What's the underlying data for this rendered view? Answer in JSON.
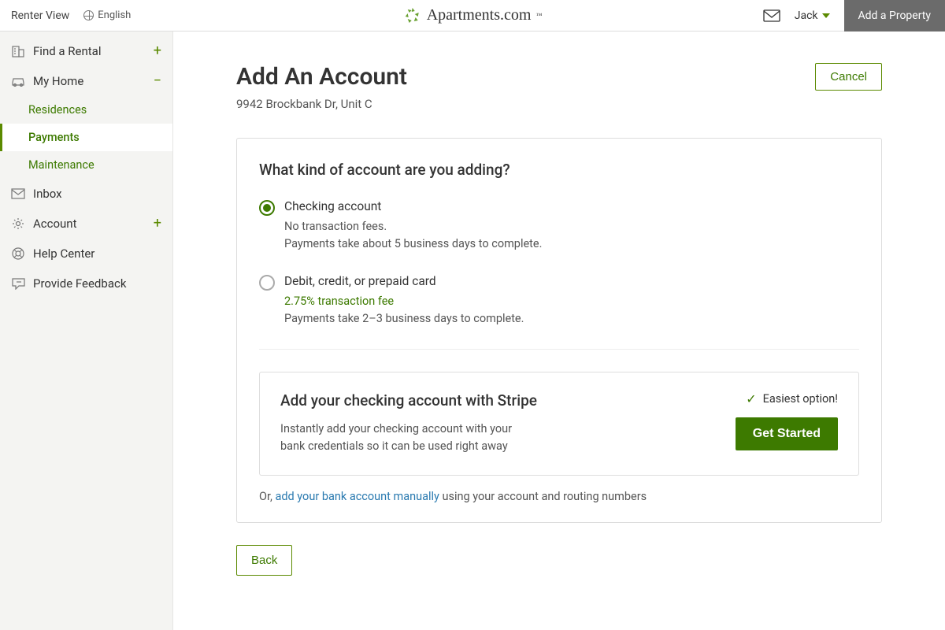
{
  "header": {
    "renter_view": "Renter View",
    "language": "English",
    "logo_text": "Apartments.com",
    "user_name": "Jack",
    "add_property": "Add a Property"
  },
  "sidebar": {
    "find_rental": "Find a Rental",
    "my_home": "My Home",
    "residences": "Residences",
    "payments": "Payments",
    "maintenance": "Maintenance",
    "inbox": "Inbox",
    "account": "Account",
    "help_center": "Help Center",
    "feedback": "Provide Feedback"
  },
  "page": {
    "title": "Add An Account",
    "cancel": "Cancel",
    "address": "9942 Brockbank Dr, Unit C",
    "question": "What kind of account are you adding?",
    "checking_label": "Checking account",
    "checking_sub1": "No transaction fees.",
    "checking_sub2": "Payments take about 5 business days to complete.",
    "card_label": "Debit, credit, or prepaid card",
    "card_fee": "2.75% transaction fee",
    "card_sub": "Payments take 2–3 business days to complete.",
    "stripe_title": "Add your checking account with Stripe",
    "stripe_desc": "Instantly add your checking account with your bank credentials so it can be used right away",
    "easiest": "Easiest option!",
    "get_started": "Get Started",
    "manual_prefix": "Or, ",
    "manual_link": "add your bank account manually",
    "manual_suffix": " using your account and routing numbers",
    "back": "Back"
  }
}
